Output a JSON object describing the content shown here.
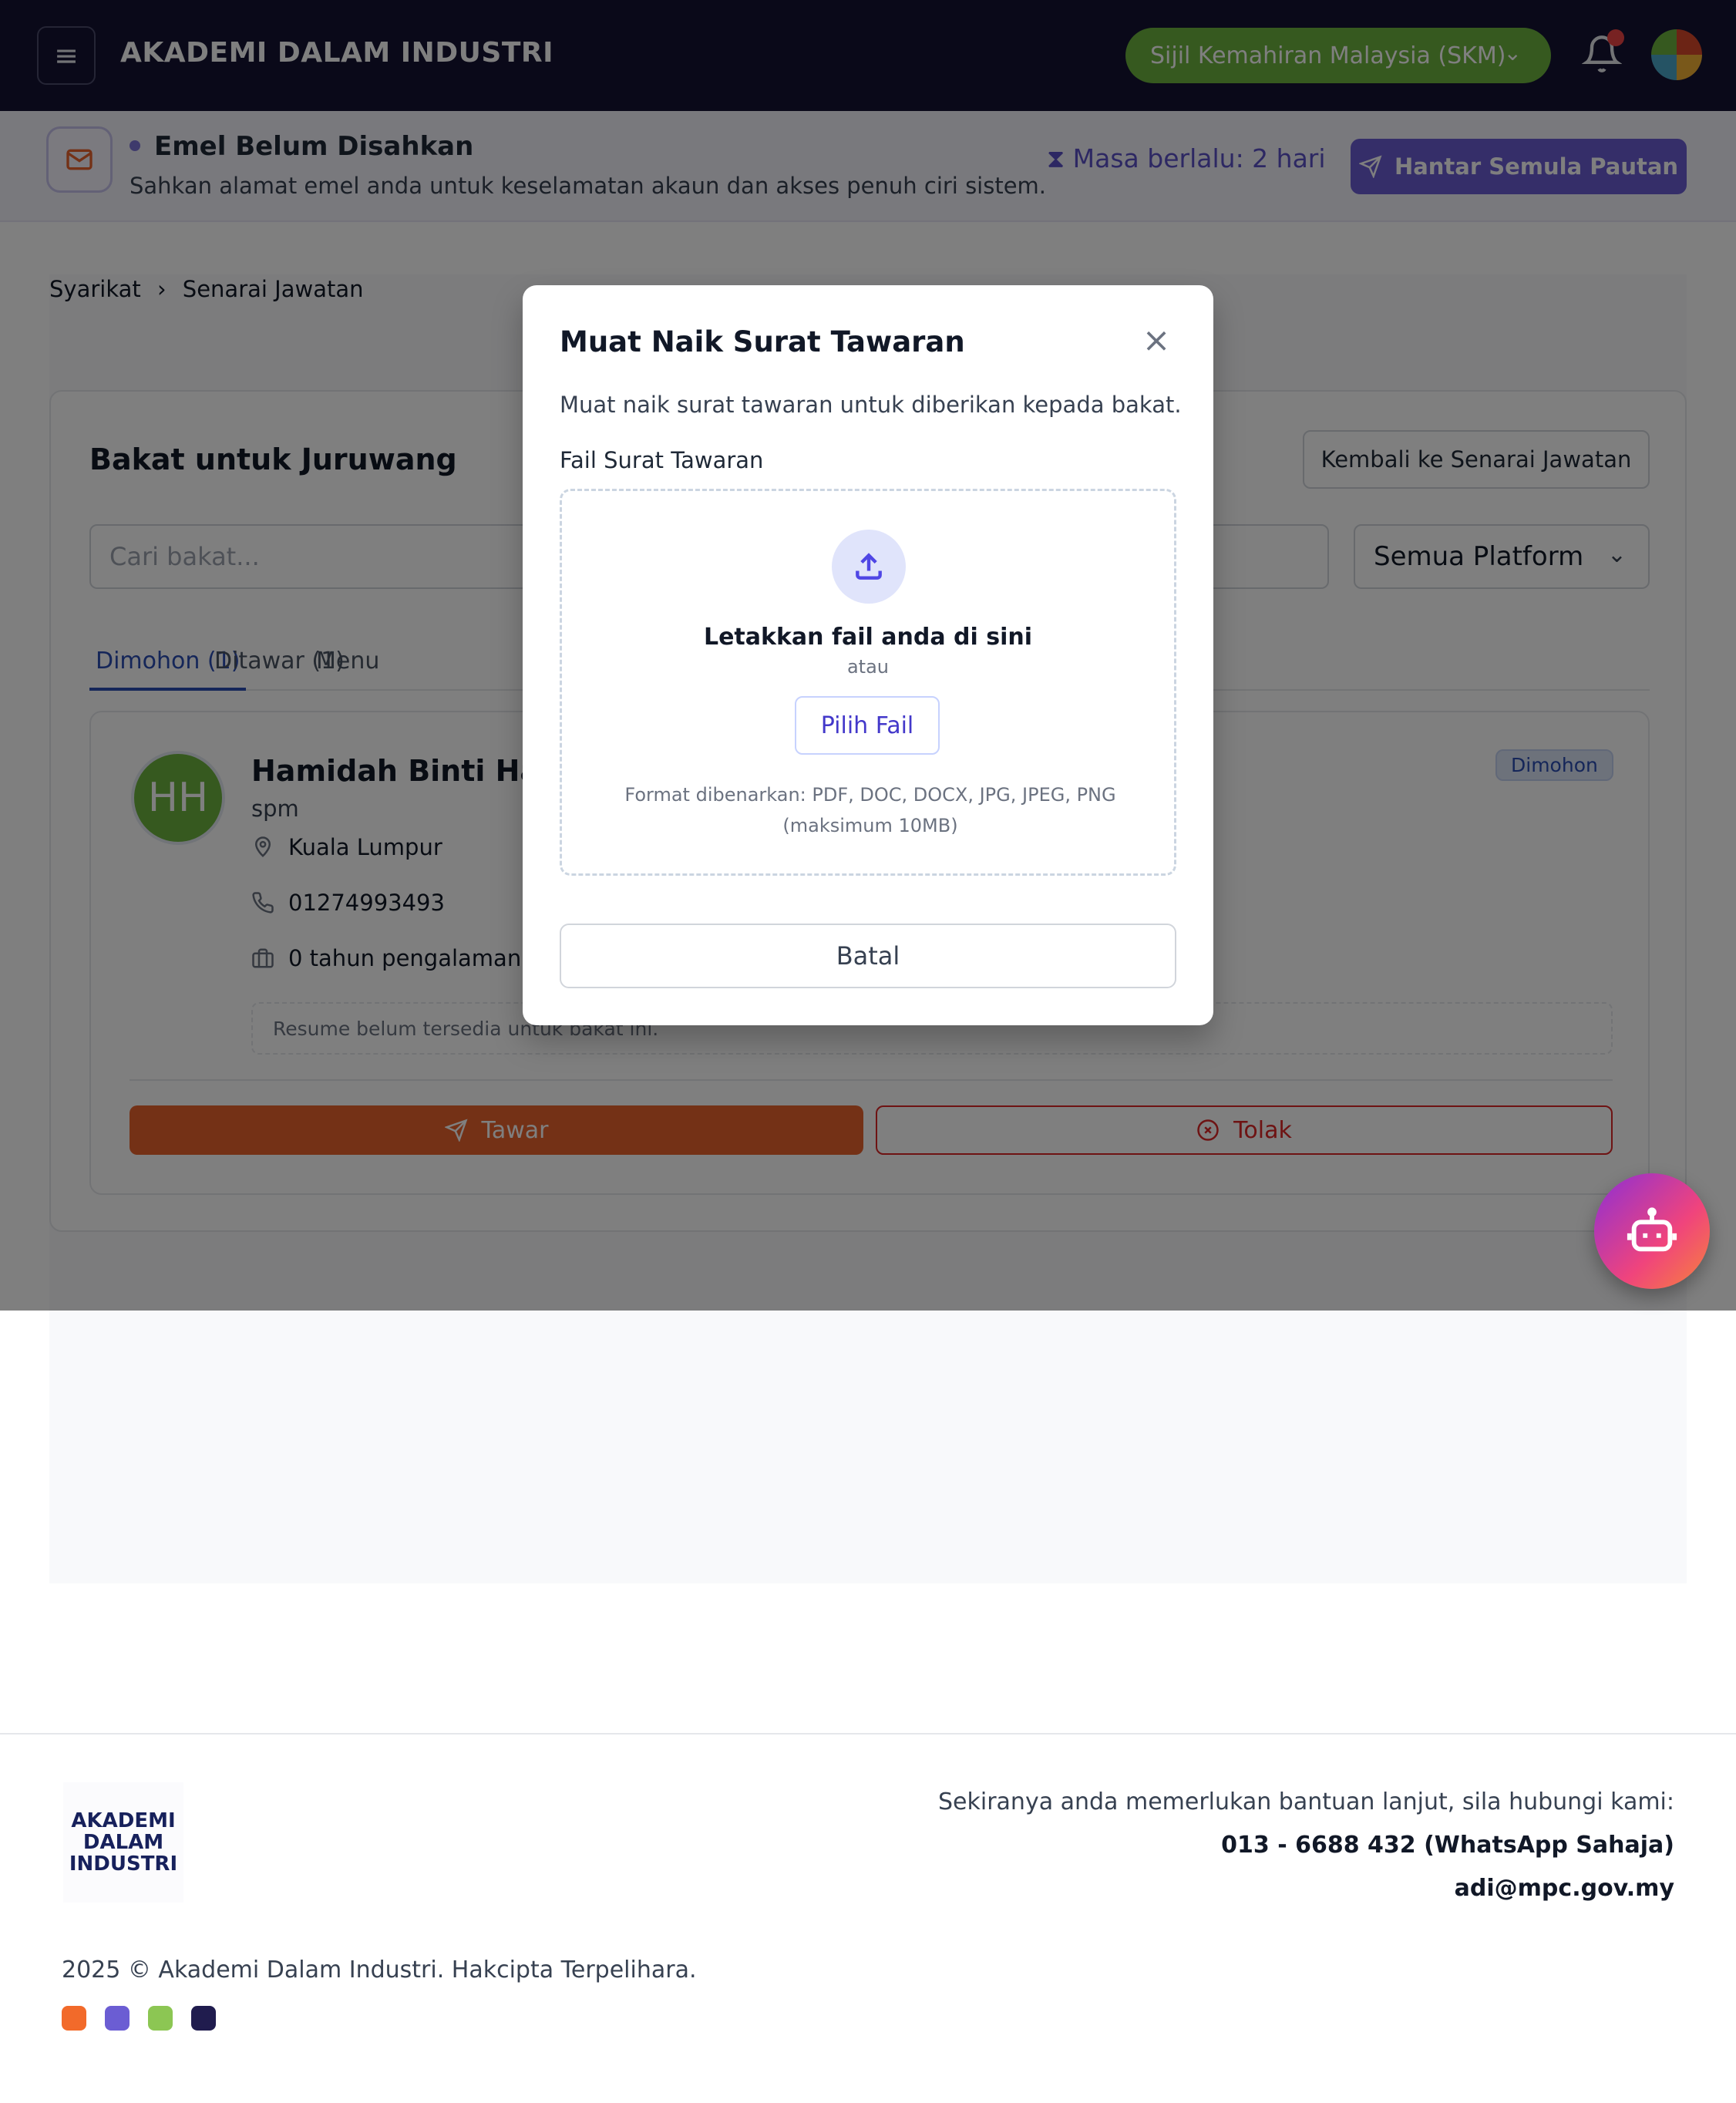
{
  "nav": {
    "brand": "AKADEMI DALAM INDUSTRI",
    "program_select": "Sijil Kemahiran Malaysia (SKM)"
  },
  "banner": {
    "title": "Emel Belum Disahkan",
    "text": "Sahkan alamat emel anda untuk keselamatan akaun dan akses penuh ciri sistem.",
    "elapsed": "Masa berlalu: 2 hari",
    "resend_label": "Hantar Semula Pautan"
  },
  "breadcrumb": {
    "items": [
      "Syarikat",
      "Senarai Jawatan"
    ]
  },
  "main": {
    "title": "Bakat untuk Juruwang",
    "back_label": "Kembali ke Senarai Jawatan",
    "search_placeholder": "Cari bakat...",
    "platform_filter": "Semua Platform",
    "tabs": [
      {
        "label": "Dimohon (1)"
      },
      {
        "label": "Ditawar (1)"
      },
      {
        "label": "Menu"
      }
    ],
    "talent": {
      "initials": "HH",
      "name": "Hamidah Binti Hass",
      "education": "spm",
      "location": "Kuala Lumpur",
      "phone": "01274993493",
      "experience": "0 tahun pengalaman",
      "status": "Dimohon",
      "resume_note": "Resume belum tersedia untuk bakat ini.",
      "offer_label": "Tawar",
      "reject_label": "Tolak"
    }
  },
  "modal": {
    "title": "Muat Naik Surat Tawaran",
    "description": "Muat naik surat tawaran untuk diberikan kepada bakat.",
    "field_label": "Fail Surat Tawaran",
    "drop_title": "Letakkan fail anda di sini",
    "or_text": "atau",
    "pick_label": "Pilih Fail",
    "formats": "Format dibenarkan: PDF, DOC, DOCX, JPG, JPEG, PNG",
    "max_size": "(maksimum 10MB)",
    "cancel_label": "Batal"
  },
  "footer": {
    "logo_lines": [
      "AKADEMI",
      "DALAM",
      "INDUSTRI"
    ],
    "help_text": "Sekiranya anda memerlukan bantuan lanjut, sila hubungi kami:",
    "phone": "013 - 6688 432 (WhatsApp Sahaja)",
    "email": "adi@mpc.gov.my",
    "copyright": "2025 © Akademi Dalam Industri. Hakcipta Terpelihara.",
    "brand_colors": [
      "#f26a2a",
      "#6b5dd3",
      "#8cc653",
      "#201c4e"
    ]
  },
  "colors": {
    "nav_bg": "#141233",
    "accent_purple": "#6b5dd3",
    "skm_green": "#6cb33f",
    "offer_orange": "#e8622c",
    "reject_red": "#dc2626"
  }
}
